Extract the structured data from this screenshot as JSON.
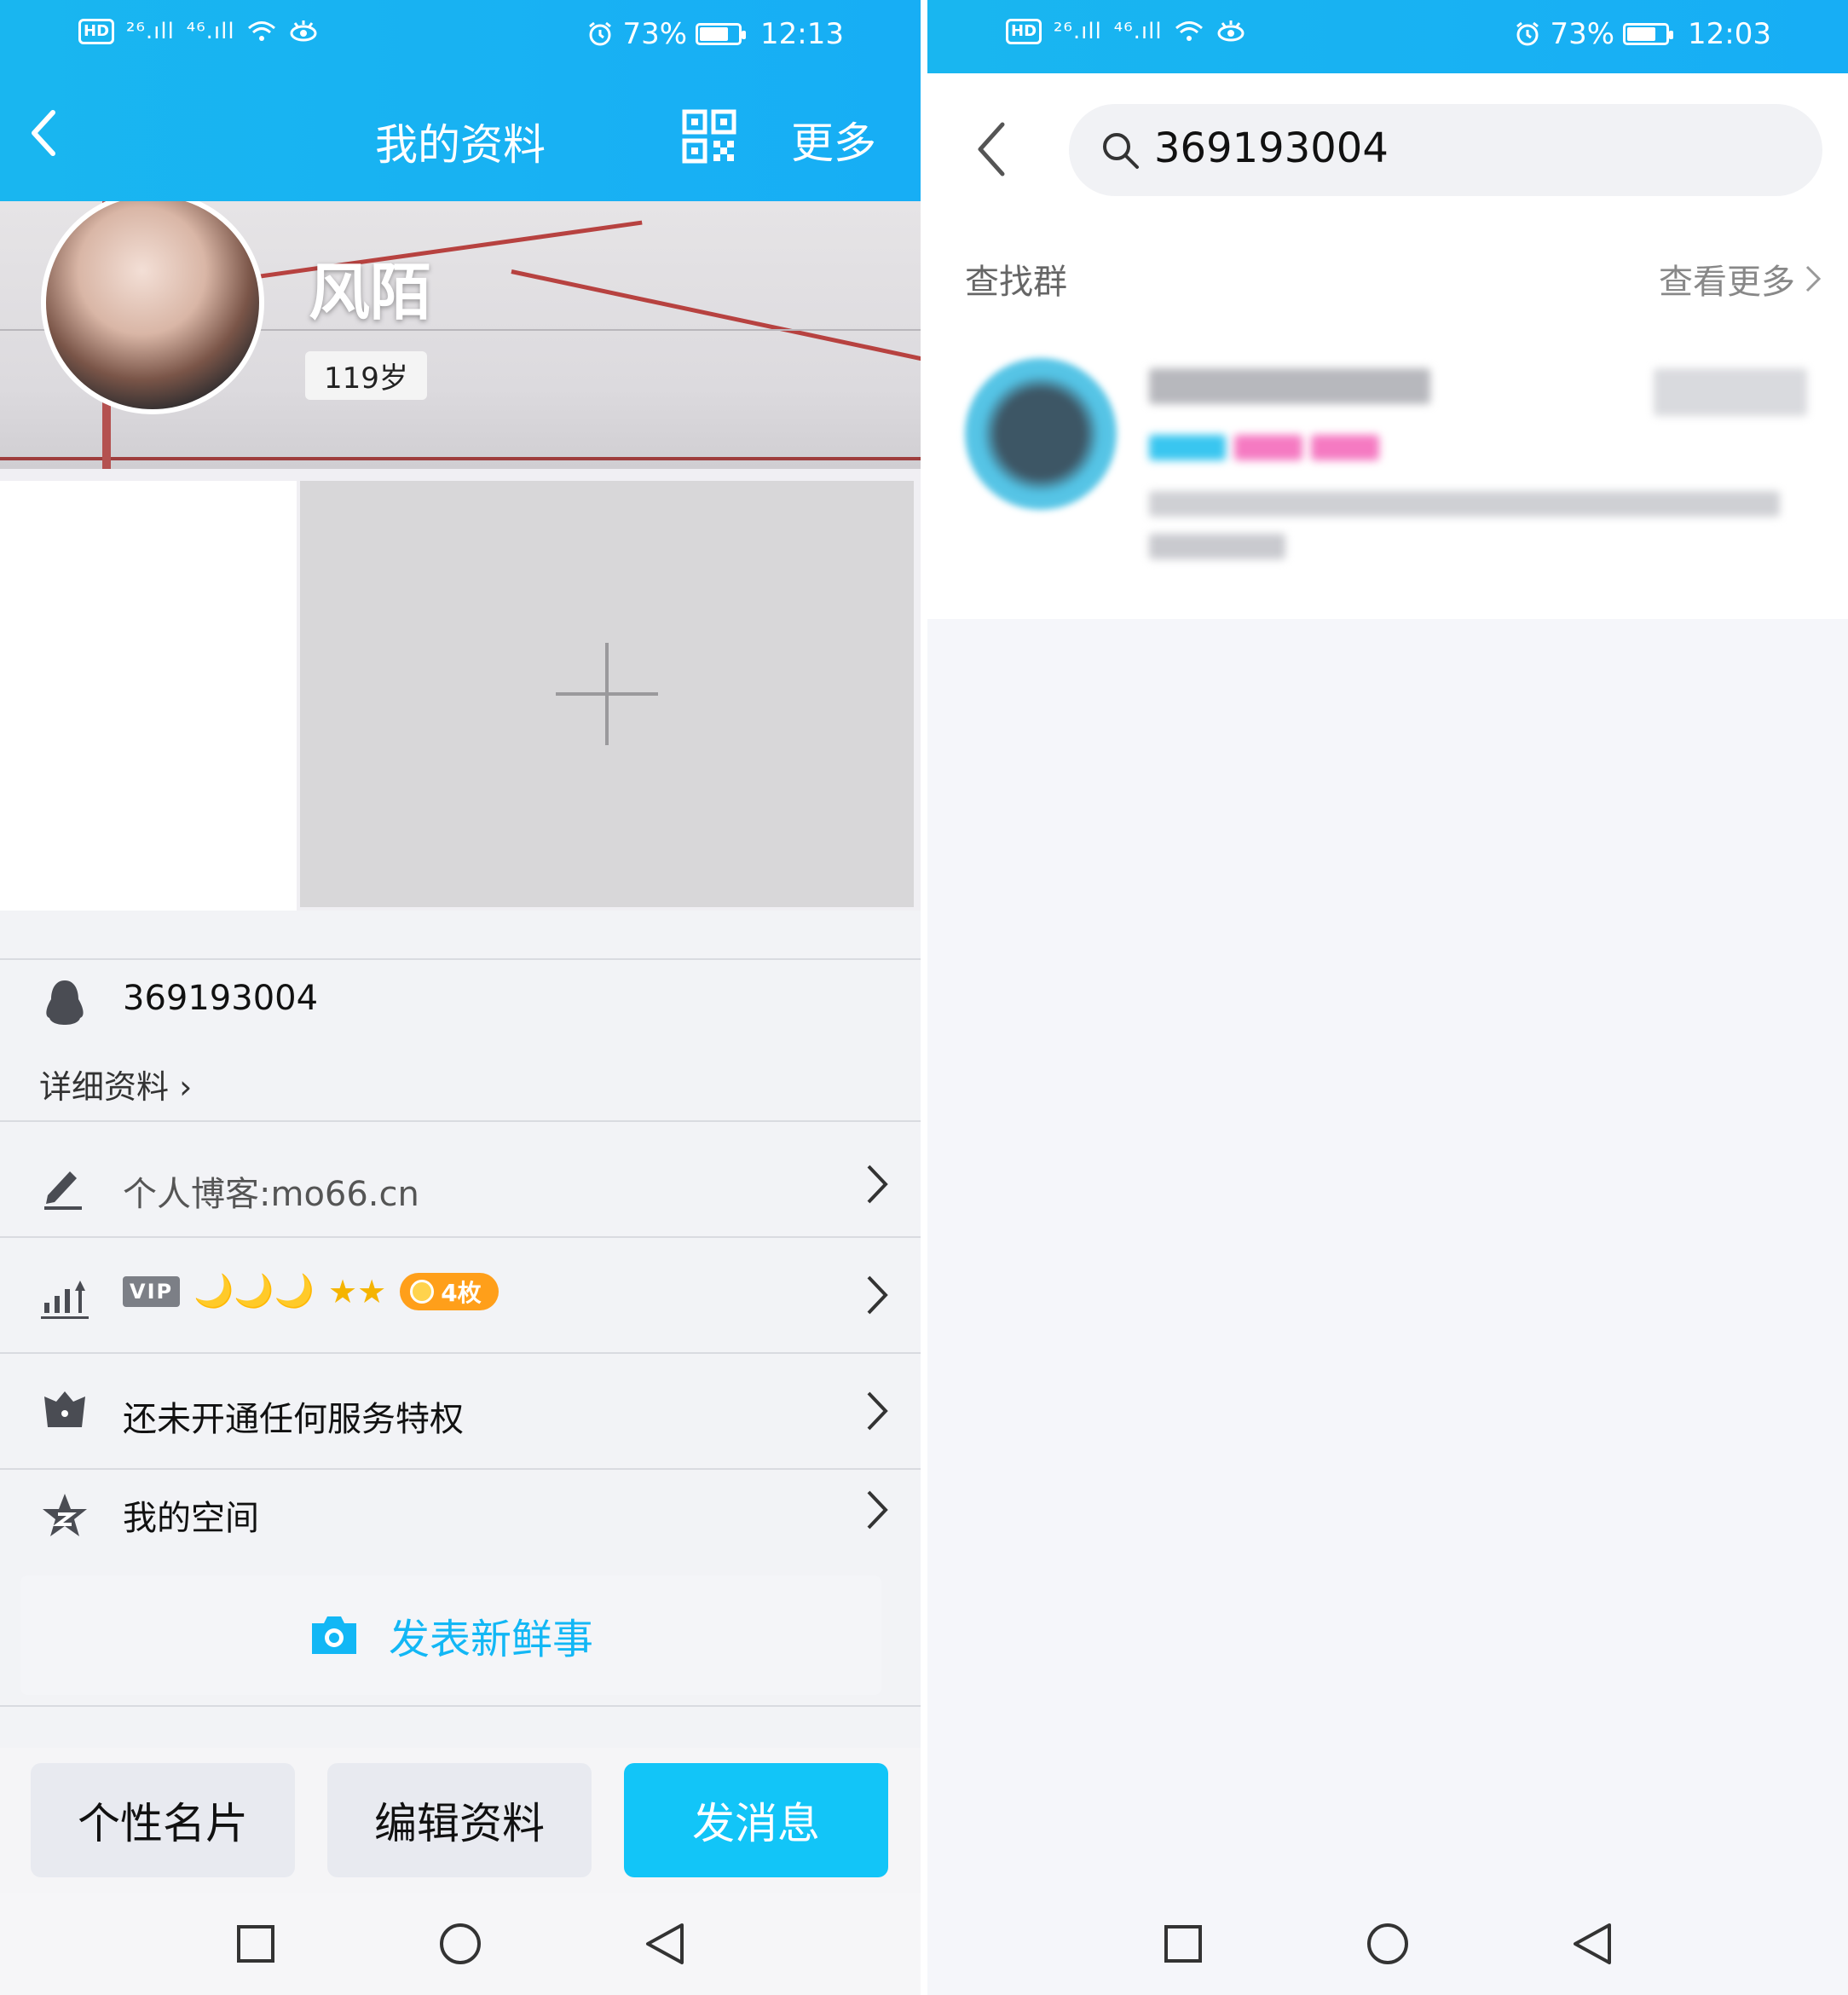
{
  "left": {
    "status": {
      "battery": "73%",
      "time": "12:13",
      "hd": "HD",
      "sim1": "²⁶.ıll",
      "sim2": "⁴⁶.ıll"
    },
    "header": {
      "title": "我的资料",
      "more": "更多"
    },
    "profile": {
      "nickname": "风陌",
      "age": "119岁"
    },
    "account": {
      "id": "369193004",
      "detail_link": "详细资料 ›"
    },
    "rows": {
      "blog": "个人博客:mo66.cn",
      "vip_badge": "VIP",
      "vip_moons": "🌙🌙🌙",
      "vip_stars": "★★",
      "coin": "4枚",
      "service": "还未开通任何服务特权",
      "space": "我的空间"
    },
    "post_button": "发表新鲜事",
    "buttons": {
      "card": "个性名片",
      "edit": "编辑资料",
      "message": "发消息"
    }
  },
  "right": {
    "status": {
      "battery": "73%",
      "time": "12:03",
      "hd": "HD",
      "sim1": "²⁶.ıll",
      "sim2": "⁴⁶.ıll"
    },
    "search": {
      "value": "369193004"
    },
    "section": {
      "label": "查找群",
      "see_more": "查看更多"
    }
  },
  "colors": {
    "accent": "#12b7f5",
    "header": "#19b6f0",
    "button_blue": "#12c5f8",
    "coin": "#ff9f1a"
  }
}
